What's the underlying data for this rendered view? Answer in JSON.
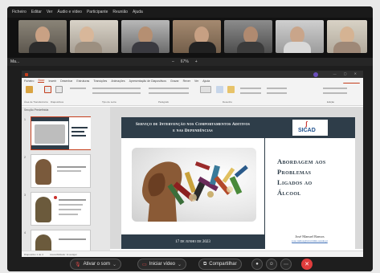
{
  "menu": [
    "Ficheiro",
    "Editar",
    "Ver",
    "Áudio e vídeo",
    "Participante",
    "Reunião",
    "Ajuda"
  ],
  "share_bar": {
    "presenter_short": "Ma...",
    "zoom_out": "–",
    "zoom_level": "67%",
    "zoom_in": "+"
  },
  "ppt": {
    "ribbon_tabs": [
      "Ficheiro",
      "Base",
      "Inserir",
      "Desenhar",
      "Estruturas",
      "Transições",
      "Animações",
      "Apresentação de Diapositivos",
      "Gravar",
      "Rever",
      "Ver",
      "Ajuda"
    ],
    "active_tab": "Base",
    "share_label": "Partilhar",
    "ribbon_groups": [
      "Área de Transferência",
      "Diapositivos",
      "Tipo de Letra",
      "Parágrafo",
      "Desenho",
      "Edição"
    ],
    "panel_header": "Secção Predefinida",
    "thumb_numbers": [
      "1",
      "2",
      "3",
      "4"
    ],
    "status": [
      "Diapositivo 1 de 4",
      "Acessibilidade: Investigar"
    ]
  },
  "slide": {
    "header_line1": "Serviço de Intervenção nos Comportamentos Aditivos",
    "header_line2": "e nas Dependências",
    "logo_text": "SICAD",
    "title_lines": [
      "Abordagem aos",
      "Problemas",
      "Ligados ao",
      "Álcool"
    ],
    "date": "17 de junho de 2023",
    "author": "José Manuel Ramos",
    "email": "jose.ramos@sicad.min-saude.pt"
  },
  "controls": {
    "audio_label": "Ativar o som",
    "video_label": "Iniciar vídeo",
    "share_label": "Compartilhar"
  },
  "colors": {
    "slide_navy": "#2e3d49",
    "ppt_accent": "#c43e1c",
    "end_call": "#e03c3c"
  }
}
